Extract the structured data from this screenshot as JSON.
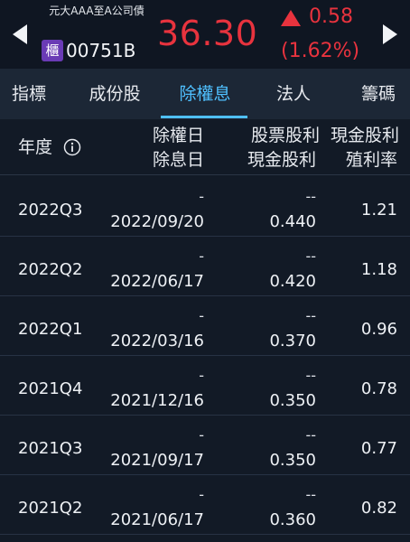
{
  "header": {
    "stock_name": "元大AAA至A公司債",
    "market_badge": "櫃",
    "stock_code": "00751B",
    "price": "36.30",
    "change_value": "0.58",
    "change_percent": "(1.62%)",
    "change_direction": "up",
    "colors": {
      "up": "#e8333e",
      "badge": "#6a3bb5",
      "accent": "#4fc0ff"
    }
  },
  "tabs": [
    {
      "label": "指標",
      "active": false
    },
    {
      "label": "成份股",
      "active": false
    },
    {
      "label": "除權息",
      "active": true
    },
    {
      "label": "法人",
      "active": false
    },
    {
      "label": "籌碼",
      "active": false
    }
  ],
  "table": {
    "columns": {
      "year": "年度",
      "ex_rights_date": "除權日",
      "ex_dividend_date": "除息日",
      "stock_dividend": "股票股利",
      "cash_dividend": "現金股利",
      "cash_dividend_top": "現金股利",
      "yield": "殖利率"
    },
    "rows": [
      {
        "period": "2022Q3",
        "ex_rights": "-",
        "ex_dividend": "2022/09/20",
        "stock_dividend": "--",
        "cash_dividend": "0.440",
        "yield": "1.21"
      },
      {
        "period": "2022Q2",
        "ex_rights": "-",
        "ex_dividend": "2022/06/17",
        "stock_dividend": "--",
        "cash_dividend": "0.420",
        "yield": "1.18"
      },
      {
        "period": "2022Q1",
        "ex_rights": "-",
        "ex_dividend": "2022/03/16",
        "stock_dividend": "--",
        "cash_dividend": "0.370",
        "yield": "0.96"
      },
      {
        "period": "2021Q4",
        "ex_rights": "-",
        "ex_dividend": "2021/12/16",
        "stock_dividend": "--",
        "cash_dividend": "0.350",
        "yield": "0.78"
      },
      {
        "period": "2021Q3",
        "ex_rights": "-",
        "ex_dividend": "2021/09/17",
        "stock_dividend": "--",
        "cash_dividend": "0.350",
        "yield": "0.77"
      },
      {
        "period": "2021Q2",
        "ex_rights": "-",
        "ex_dividend": "2021/06/17",
        "stock_dividend": "--",
        "cash_dividend": "0.360",
        "yield": "0.82"
      }
    ]
  }
}
